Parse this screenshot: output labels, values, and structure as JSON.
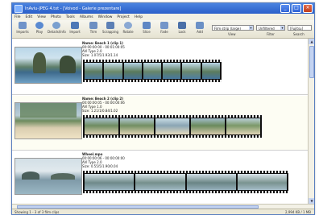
{
  "window": {
    "title": "InAviu-JPEG 4.txt - [Voivod - Galerie prezentare]",
    "buttons": [
      "_",
      "□",
      "×"
    ]
  },
  "menu": [
    "File",
    "Edit",
    "View",
    "Photo",
    "Tools",
    "Albums",
    "Window",
    "Project",
    "Help"
  ],
  "toolbar": {
    "tools": [
      {
        "label": "Imports",
        "icon": "import-icon"
      },
      {
        "label": "Play",
        "icon": "play-icon"
      },
      {
        "label": "Details/Info",
        "icon": "info-icon"
      },
      {
        "label": "Import",
        "icon": "camera-icon"
      },
      {
        "label": "Trim",
        "icon": "trim-icon"
      },
      {
        "label": "Scrapping",
        "icon": "scrap-icon"
      },
      {
        "label": "Rotate",
        "icon": "rotate-icon"
      },
      {
        "label": "Slice",
        "icon": "slice-icon"
      },
      {
        "label": "Fade",
        "icon": "fade-icon"
      },
      {
        "label": "Lock",
        "icon": "lock-icon"
      },
      {
        "label": "Add",
        "icon": "add-icon"
      }
    ],
    "view_combo": "Film strip (large)",
    "filter_combo": "Unfiltered",
    "search_combo": "[Fujitsu]",
    "group_labels": [
      "View",
      "Filter",
      "Search"
    ]
  },
  "clips": [
    {
      "name": "Name: Beach 1 (clip 1)",
      "lines": [
        "00:00:00:00 - 00:01:00:05",
        "AVI Type 2.0",
        "Size: 1.07/5/1.93/1.14"
      ],
      "selected": false
    },
    {
      "name": "Name: Beach 2 (clip 2)",
      "lines": [
        "00:00:00:05 - 00:00:00:06",
        "AVI Type 1.0",
        "Size: 1.21/1/0.84/1.02"
      ],
      "selected": true
    },
    {
      "name": "Wheel.mpo",
      "lines": [
        "00:00:00:06 - 00:00:00:00",
        "AVI Type 2.0",
        "Size: 0.55/5/1.90/0.04"
      ],
      "selected": false
    }
  ],
  "status": {
    "left": "Showing 1 - 3 of 3 film clips",
    "right": "2,994 KB / 1 MB"
  },
  "colors": {
    "titlebar": "#2a5fc9",
    "film": "#111111",
    "selection": "#fdfdf3"
  }
}
